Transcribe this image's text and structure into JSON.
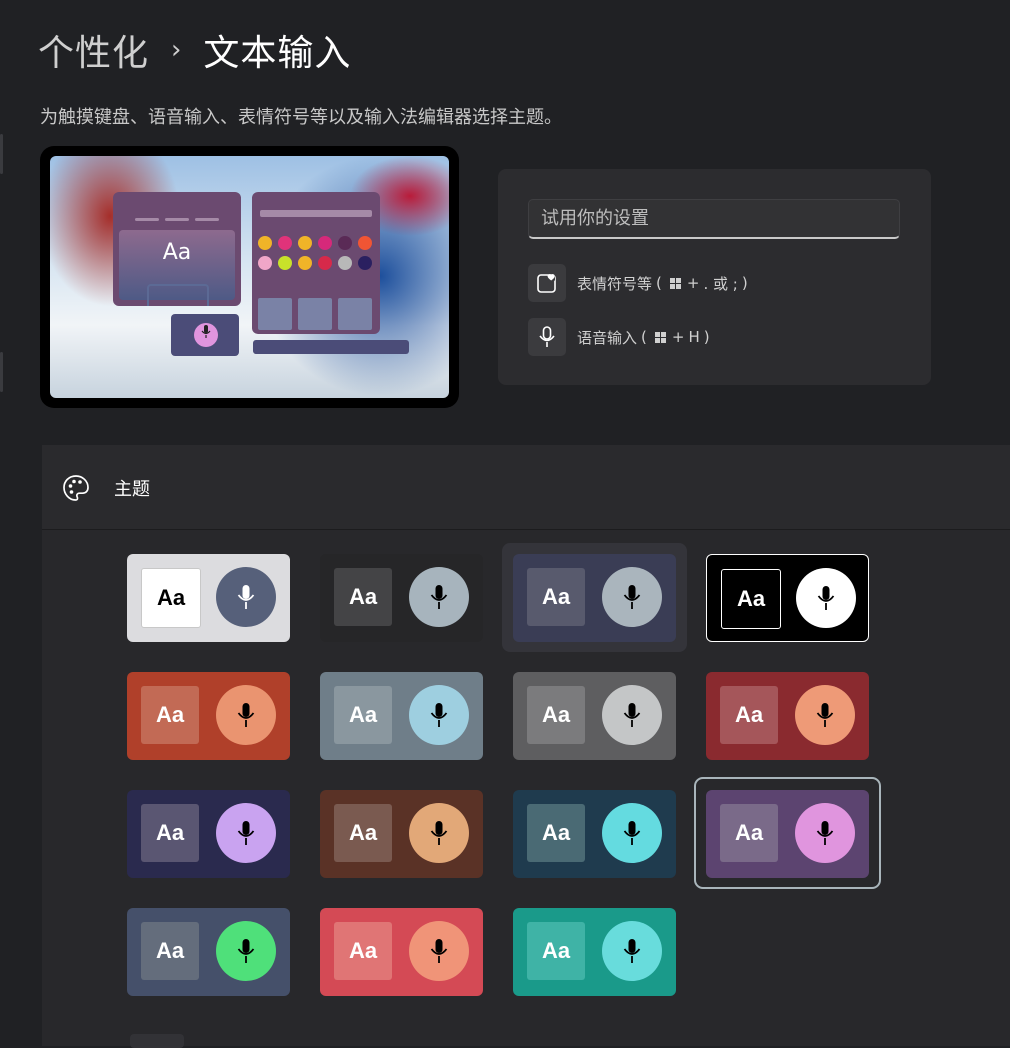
{
  "breadcrumb": {
    "parent": "个性化",
    "separator": "›",
    "current": "文本输入"
  },
  "description": "为触摸键盘、语音输入、表情符号等以及输入法编辑器选择主题。",
  "preview": {
    "keyboard_label": "Aa"
  },
  "try_panel": {
    "input_placeholder": "试用你的设置",
    "emoji_shortcut": {
      "label": "表情符号等",
      "open": "(",
      "plus": "+",
      "keys": ". 或 ;",
      "close": ")"
    },
    "voice_shortcut": {
      "label": "语音输入",
      "open": "(",
      "plus": "+",
      "keys": "H",
      "close": ")"
    }
  },
  "theme_section": {
    "title": "主题",
    "icon": "palette-icon"
  },
  "themes": [
    {
      "aa": "Aa",
      "bg": "#dcdcdf",
      "aa_bg": "#ffffff",
      "aa_fg": "#000000",
      "mic_bg": "#56607a",
      "mic_fg": "#ffffff"
    },
    {
      "aa": "Aa",
      "bg": "#262628",
      "aa_bg": "#444446",
      "aa_fg": "#ffffff",
      "mic_bg": "#a7b4bd",
      "mic_fg": "#000000"
    },
    {
      "aa": "Aa",
      "bg": "#3a3d55",
      "aa_bg": "#585a6d",
      "aa_fg": "#ffffff",
      "mic_bg": "#aab5bd",
      "mic_fg": "#000000"
    },
    {
      "aa": "Aa",
      "bg": "#000000",
      "aa_bg": "#000000",
      "aa_fg": "#ffffff",
      "mic_bg": "#ffffff",
      "mic_fg": "#000000"
    },
    {
      "aa": "Aa",
      "bg": "#b0402a",
      "aa_bg": "#c26a55",
      "aa_fg": "#ffffff",
      "mic_bg": "#ea9470",
      "mic_fg": "#000000"
    },
    {
      "aa": "Aa",
      "bg": "#6f7e89",
      "aa_bg": "#8a979f",
      "aa_fg": "#ffffff",
      "mic_bg": "#9ecfe0",
      "mic_fg": "#000000"
    },
    {
      "aa": "Aa",
      "bg": "#5e5e60",
      "aa_bg": "#7b7b7d",
      "aa_fg": "#ffffff",
      "mic_bg": "#c4c6c7",
      "mic_fg": "#000000"
    },
    {
      "aa": "Aa",
      "bg": "#8a2a2f",
      "aa_bg": "#a5565a",
      "aa_fg": "#ffffff",
      "mic_bg": "#ee9a77",
      "mic_fg": "#000000"
    },
    {
      "aa": "Aa",
      "bg": "#2a2a4e",
      "aa_bg": "#5a5672",
      "aa_fg": "#ffffff",
      "mic_bg": "#c9a3f0",
      "mic_fg": "#000000"
    },
    {
      "aa": "Aa",
      "bg": "#5a3226",
      "aa_bg": "#7a5a50",
      "aa_fg": "#ffffff",
      "mic_bg": "#e2a878",
      "mic_fg": "#000000"
    },
    {
      "aa": "Aa",
      "bg": "#1f3b4e",
      "aa_bg": "#4a6a74",
      "aa_fg": "#ffffff",
      "mic_bg": "#64dbe0",
      "mic_fg": "#000000"
    },
    {
      "aa": "Aa",
      "bg": "#5c4470",
      "aa_bg": "#7a6a89",
      "aa_fg": "#ffffff",
      "mic_bg": "#e095de",
      "mic_fg": "#000000"
    },
    {
      "aa": "Aa",
      "bg": "#45506a",
      "aa_bg": "#646d7c",
      "aa_fg": "#ffffff",
      "mic_bg": "#4fe07a",
      "mic_fg": "#000000"
    },
    {
      "aa": "Aa",
      "bg": "#d44a55",
      "aa_bg": "#e07575",
      "aa_fg": "#ffffff",
      "mic_bg": "#f09478",
      "mic_fg": "#000000"
    },
    {
      "aa": "Aa",
      "bg": "#1a9a8a",
      "aa_bg": "#3fb3a6",
      "aa_fg": "#ffffff",
      "mic_bg": "#68dcdc",
      "mic_fg": "#000000"
    }
  ]
}
